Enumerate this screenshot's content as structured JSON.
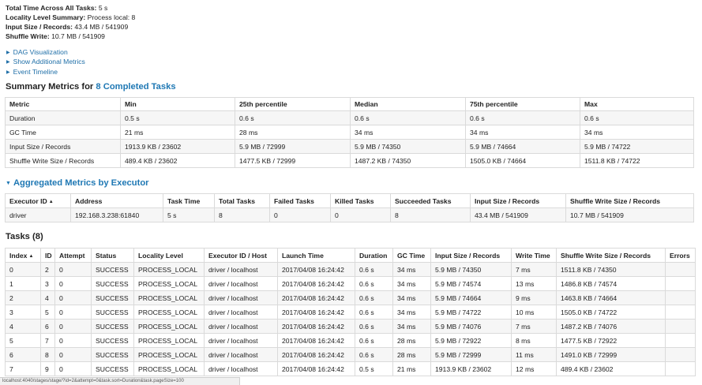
{
  "overview": {
    "total_time_label": "Total Time Across All Tasks:",
    "total_time_value": "5 s",
    "locality_label": "Locality Level Summary:",
    "locality_value": "Process local: 8",
    "input_label": "Input Size / Records:",
    "input_value": "43.4 MB / 541909",
    "shuffle_label": "Shuffle Write:",
    "shuffle_value": "10.7 MB / 541909"
  },
  "links": [
    "DAG Visualization",
    "Show Additional Metrics",
    "Event Timeline"
  ],
  "summary_metrics": {
    "title_prefix": "Summary Metrics for ",
    "title_link": "8 Completed Tasks",
    "headers": [
      "Metric",
      "Min",
      "25th percentile",
      "Median",
      "75th percentile",
      "Max"
    ],
    "rows": [
      [
        "Duration",
        "0.5 s",
        "0.6 s",
        "0.6 s",
        "0.6 s",
        "0.6 s"
      ],
      [
        "GC Time",
        "21 ms",
        "28 ms",
        "34 ms",
        "34 ms",
        "34 ms"
      ],
      [
        "Input Size / Records",
        "1913.9 KB / 23602",
        "5.9 MB / 72999",
        "5.9 MB / 74350",
        "5.9 MB / 74664",
        "5.9 MB / 74722"
      ],
      [
        "Shuffle Write Size / Records",
        "489.4 KB / 23602",
        "1477.5 KB / 72999",
        "1487.2 KB / 74350",
        "1505.0 KB / 74664",
        "1511.8 KB / 74722"
      ]
    ]
  },
  "aggregated": {
    "title": "Aggregated Metrics by Executor",
    "headers": [
      "Executor ID",
      "Address",
      "Task Time",
      "Total Tasks",
      "Failed Tasks",
      "Killed Tasks",
      "Succeeded Tasks",
      "Input Size / Records",
      "Shuffle Write Size / Records"
    ],
    "rows": [
      [
        "driver",
        "192.168.3.238:61840",
        "5 s",
        "8",
        "0",
        "0",
        "8",
        "43.4 MB / 541909",
        "10.7 MB / 541909"
      ]
    ]
  },
  "tasks": {
    "title": "Tasks (8)",
    "headers": [
      "Index",
      "ID",
      "Attempt",
      "Status",
      "Locality Level",
      "Executor ID / Host",
      "Launch Time",
      "Duration",
      "GC Time",
      "Input Size / Records",
      "Write Time",
      "Shuffle Write Size / Records",
      "Errors"
    ],
    "rows": [
      [
        "0",
        "2",
        "0",
        "SUCCESS",
        "PROCESS_LOCAL",
        "driver / localhost",
        "2017/04/08 16:24:42",
        "0.6 s",
        "34 ms",
        "5.9 MB / 74350",
        "7 ms",
        "1511.8 KB / 74350",
        ""
      ],
      [
        "1",
        "3",
        "0",
        "SUCCESS",
        "PROCESS_LOCAL",
        "driver / localhost",
        "2017/04/08 16:24:42",
        "0.6 s",
        "34 ms",
        "5.9 MB / 74574",
        "13 ms",
        "1486.8 KB / 74574",
        ""
      ],
      [
        "2",
        "4",
        "0",
        "SUCCESS",
        "PROCESS_LOCAL",
        "driver / localhost",
        "2017/04/08 16:24:42",
        "0.6 s",
        "34 ms",
        "5.9 MB / 74664",
        "9 ms",
        "1463.8 KB / 74664",
        ""
      ],
      [
        "3",
        "5",
        "0",
        "SUCCESS",
        "PROCESS_LOCAL",
        "driver / localhost",
        "2017/04/08 16:24:42",
        "0.6 s",
        "34 ms",
        "5.9 MB / 74722",
        "10 ms",
        "1505.0 KB / 74722",
        ""
      ],
      [
        "4",
        "6",
        "0",
        "SUCCESS",
        "PROCESS_LOCAL",
        "driver / localhost",
        "2017/04/08 16:24:42",
        "0.6 s",
        "34 ms",
        "5.9 MB / 74076",
        "7 ms",
        "1487.2 KB / 74076",
        ""
      ],
      [
        "5",
        "7",
        "0",
        "SUCCESS",
        "PROCESS_LOCAL",
        "driver / localhost",
        "2017/04/08 16:24:42",
        "0.6 s",
        "28 ms",
        "5.9 MB / 72922",
        "8 ms",
        "1477.5 KB / 72922",
        ""
      ],
      [
        "6",
        "8",
        "0",
        "SUCCESS",
        "PROCESS_LOCAL",
        "driver / localhost",
        "2017/04/08 16:24:42",
        "0.6 s",
        "28 ms",
        "5.9 MB / 72999",
        "11 ms",
        "1491.0 KB / 72999",
        ""
      ],
      [
        "7",
        "9",
        "0",
        "SUCCESS",
        "PROCESS_LOCAL",
        "driver / localhost",
        "2017/04/08 16:24:42",
        "0.5 s",
        "21 ms",
        "1913.9 KB / 23602",
        "12 ms",
        "489.4 KB / 23602",
        ""
      ]
    ]
  },
  "statusbar_text": "localhost:4040/stages/stage/?id=2&attempt=0&task.sort=Duration&task.pageSize=100"
}
